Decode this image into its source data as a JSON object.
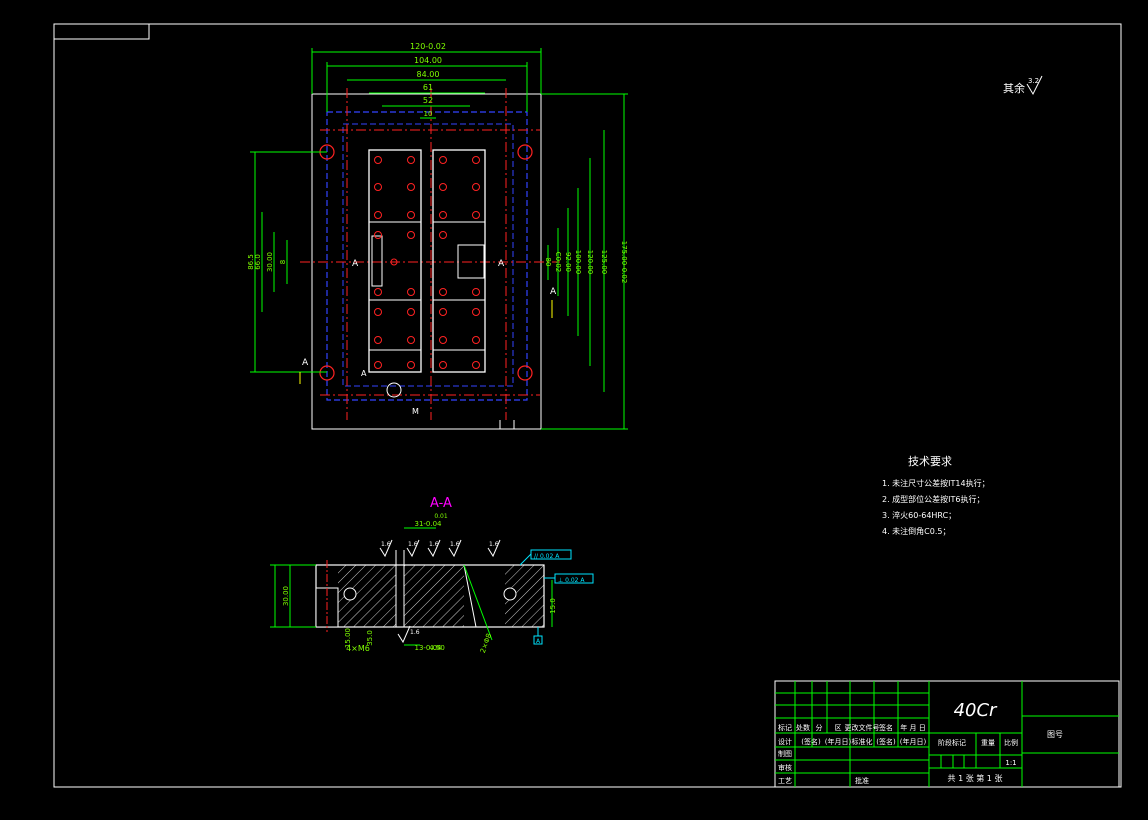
{
  "drawing": {
    "colors": {
      "background": "#000000",
      "frame": "#ffffff",
      "dimension": "#00ff00",
      "centerline": "#ff0000",
      "hidden": "#0000ff",
      "section_label": "#ff00ff",
      "hatch": "#ffffff",
      "cyan": "#00e5ff",
      "yellow": "#ffff00"
    },
    "roughness_note": {
      "text": "其余",
      "value": "3.2"
    },
    "plan_view": {
      "top_dims": [
        "120-0.02",
        "104.00",
        "84.00",
        "61",
        "52",
        "10"
      ],
      "right_dims": [
        "80",
        "C0.02",
        "92.00",
        "100.00",
        "120.00",
        "125.00",
        "175.00-0.02"
      ],
      "left_dims": [
        "8",
        "30.00",
        "66.0",
        "86.5"
      ],
      "section_marks": [
        "A",
        "A",
        "A",
        "A",
        "A"
      ],
      "bottom_mark": "M"
    },
    "section_view": {
      "title": "A-A",
      "dims": [
        "31-0.04",
        "0.01",
        "13-0.04",
        "30.00",
        "15.00",
        "4×M6",
        "35.0",
        "4.50",
        "2×Φ8",
        "15.0"
      ],
      "roughness": [
        "1.6",
        "1.6",
        "1.6",
        "1.6",
        "1.6",
        "1.6"
      ],
      "gdt": [
        "// 0.02 A",
        "⊥ 0.02 A"
      ],
      "datum": "A"
    },
    "tech_requirements": {
      "title": "技术要求",
      "items": [
        "1. 未注尺寸公差按IT14执行；",
        "2. 成型部位公差按IT6执行；",
        "3. 淬火60-64HRC；",
        "4. 未注倒角C0.5；"
      ]
    },
    "title_block": {
      "material": "40Cr",
      "drawing_no": "图号",
      "row_headers": [
        "标记",
        "处数",
        "分",
        "区",
        "更改文件号",
        "签名",
        "年 月 日"
      ],
      "row_design": [
        "设计",
        "(签名)",
        "(年月日)",
        "标准化",
        "(签名)",
        "(年月日)"
      ],
      "labels": [
        "阶段标记",
        "重量",
        "比例"
      ],
      "scale": "1:1",
      "row_drafting": "制图",
      "row_review": "审核",
      "row_process": "工艺",
      "approve": "批准",
      "sheets": "共  1  张    第  1  张"
    }
  }
}
